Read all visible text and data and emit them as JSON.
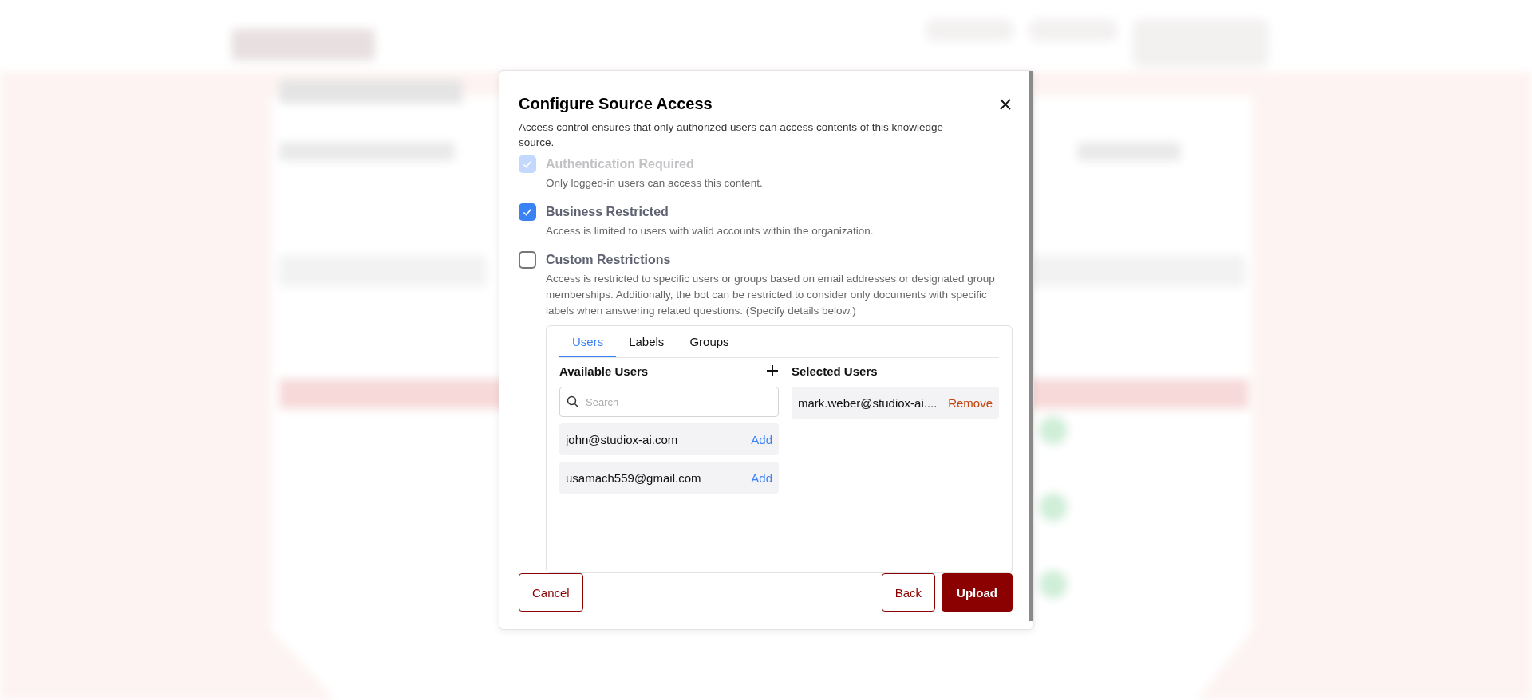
{
  "dialog": {
    "title": "Configure Source Access",
    "description": "Access control ensures that only authorized users can access contents of this knowledge source.",
    "options": [
      {
        "label": "Authentication Required",
        "description": "Only logged-in users can access this content.",
        "checked": true,
        "disabled": true
      },
      {
        "label": "Business Restricted",
        "description": "Access is limited to users with valid accounts within the organization.",
        "checked": true,
        "disabled": false
      },
      {
        "label": "Custom Restrictions",
        "description": "Access is restricted to specific users or groups based on email addresses or designated group memberships. Additionally, the bot can be restricted to consider only documents with specific labels when answering related questions. (Specify details below.)",
        "checked": false,
        "disabled": false
      }
    ],
    "tabs": [
      {
        "label": "Users",
        "selected": true
      },
      {
        "label": "Labels",
        "selected": false
      },
      {
        "label": "Groups",
        "selected": false
      }
    ],
    "available_users": {
      "heading": "Available Users",
      "search": {
        "placeholder": "Search"
      },
      "items": [
        {
          "email": "john@studiox-ai.com",
          "action": "Add"
        },
        {
          "email": "usamach559@gmail.com",
          "action": "Add"
        }
      ]
    },
    "selected_users": {
      "heading": "Selected Users",
      "items": [
        {
          "email": "mark.weber@studiox-ai....",
          "action": "Remove"
        }
      ]
    },
    "buttons": {
      "cancel": "Cancel",
      "back": "Back",
      "upload": "Upload"
    }
  }
}
